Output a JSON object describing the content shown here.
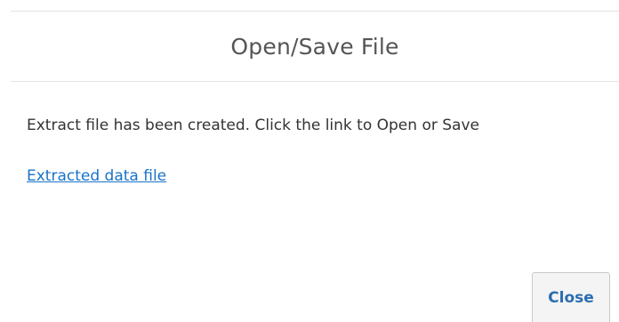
{
  "dialog": {
    "title": "Open/Save File",
    "message": "Extract file has been created. Click the link to Open or Save",
    "link_text": "Extracted data file",
    "close_label": "Close"
  },
  "colors": {
    "link": "#1a73c8",
    "close_text": "#2a6eb0",
    "button_bg": "#f4f4f4"
  }
}
